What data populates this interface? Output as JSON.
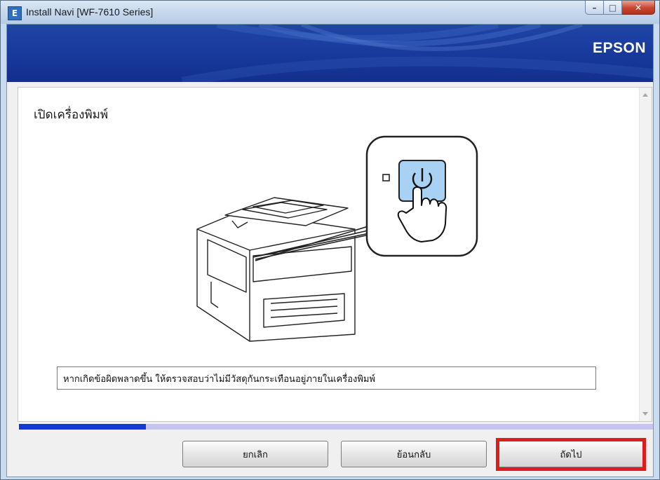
{
  "window": {
    "title": "Install Navi [WF-7610 Series]",
    "icon": "app-e-icon",
    "controls": {
      "minimize": "–",
      "maximize": "□",
      "close": "✕"
    }
  },
  "banner": {
    "brand": "EPSON"
  },
  "content": {
    "heading": "เปิดเครื่องพิมพ์",
    "illustration": "printer-power-button-illustration",
    "info_text": "หากเกิดข้อผิดพลาดขึ้น ให้ตรวจสอบว่าไม่มีวัสดุกันกระเทือนอยู่ภายในเครื่องพิมพ์"
  },
  "progress": {
    "value": 0.2,
    "fill_color": "#1537d4",
    "track_color": "#c4c4ee"
  },
  "buttons": {
    "cancel": "ยกเลิก",
    "back": "ย้อนกลับ",
    "next": "ถัดไป"
  },
  "colors": {
    "banner": "#1f45a6",
    "highlight": "#e01b1b",
    "button_highlight_fill": "#a9d1f3"
  }
}
